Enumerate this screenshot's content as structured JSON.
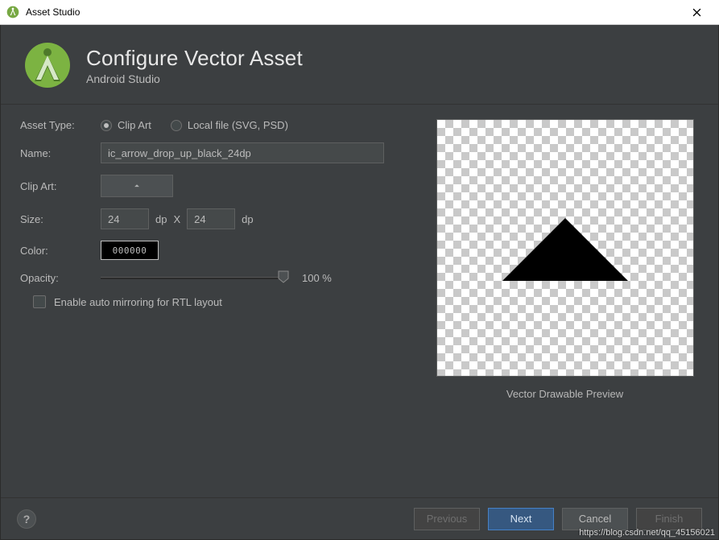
{
  "window": {
    "title": "Asset Studio"
  },
  "header": {
    "title": "Configure Vector Asset",
    "subtitle": "Android Studio"
  },
  "form": {
    "asset_type": {
      "label": "Asset Type:",
      "options": [
        {
          "label": "Clip Art",
          "selected": true
        },
        {
          "label": "Local file (SVG, PSD)",
          "selected": false
        }
      ]
    },
    "name": {
      "label": "Name:",
      "value": "ic_arrow_drop_up_black_24dp"
    },
    "clip_art": {
      "label": "Clip Art:",
      "icon": "arrow-drop-up-icon"
    },
    "size": {
      "label": "Size:",
      "width": "24",
      "height": "24",
      "unit": "dp",
      "sep": "X"
    },
    "color": {
      "label": "Color:",
      "hex": "000000"
    },
    "opacity": {
      "label": "Opacity:",
      "value": 100,
      "display": "100 %"
    },
    "rtl": {
      "label": "Enable auto mirroring for RTL layout",
      "checked": false
    }
  },
  "preview": {
    "caption": "Vector Drawable Preview"
  },
  "footer": {
    "help": "?",
    "previous": "Previous",
    "next": "Next",
    "cancel": "Cancel",
    "finish": "Finish"
  },
  "watermark": "https://blog.csdn.net/qq_45156021"
}
